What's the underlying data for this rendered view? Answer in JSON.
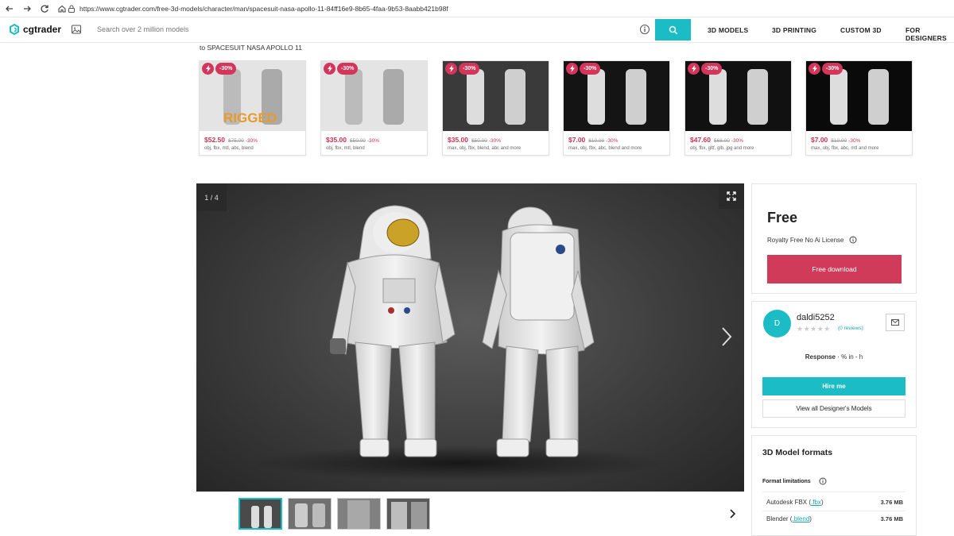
{
  "browser": {
    "url": "https://www.cgtrader.com/free-3d-models/character/man/spacesuit-nasa-apollo-11-84ff16e9-8b65-4faa-9b53-8aabb421b98f"
  },
  "header": {
    "logo_text": "cgtrader",
    "search_placeholder": "Search over 2 million models",
    "nav": [
      "3D MODELS",
      "3D PRINTING",
      "CUSTOM 3D",
      "FOR DESIGNERS"
    ]
  },
  "related": {
    "title": "to SPACESUIT NASA APOLLO 11",
    "cards": [
      {
        "discount": "-30%",
        "price": "$52.50",
        "old_price": "$75.00",
        "pct": "-30%",
        "formats": "obj, fbx, mtl, abc, blend",
        "overlay": "RIGGED"
      },
      {
        "discount": "-30%",
        "price": "$35.00",
        "old_price": "$50.00",
        "pct": "-30%",
        "formats": "obj, fbx, mtl, blend"
      },
      {
        "discount": "-30%",
        "price": "$35.00",
        "old_price": "$50.00",
        "pct": "-30%",
        "formats": "max, obj, fbx, blend, abc and more"
      },
      {
        "discount": "-30%",
        "price": "$7.00",
        "old_price": "$10.00",
        "pct": "-30%",
        "formats": "max, obj, fbx, abc, blend and more"
      },
      {
        "discount": "-30%",
        "price": "$47.60",
        "old_price": "$68.00",
        "pct": "-30%",
        "formats": "obj, fbx, gltf, glb, jpg and more"
      },
      {
        "discount": "-30%",
        "price": "$7.00",
        "old_price": "$10.00",
        "pct": "-30%",
        "formats": "max, obj, fbx, abc, mtl and more"
      }
    ]
  },
  "viewer": {
    "counter": "1 / 4"
  },
  "purchase": {
    "price": "Free",
    "license": "Royalty Free No Ai License",
    "download_label": "Free download"
  },
  "designer": {
    "initial": "D",
    "name": "daldi5252",
    "stars": "★★★★★",
    "reviews": "(0 reviews)",
    "response_label": "Response",
    "response_value": " · % in - h",
    "hire_label": "Hire me",
    "view_all_label": "View all Designer's Models"
  },
  "formats": {
    "title": "3D Model formats",
    "limitations": "Format limitations",
    "items": [
      {
        "name": "Autodesk FBX",
        "ext": ".fbx",
        "size": "3.76 MB"
      },
      {
        "name": "Blender",
        "ext": ".blend",
        "size": "3.76 MB"
      }
    ]
  },
  "colors": {
    "accent": "#1cbcc7",
    "brand_red": "#cf3b59"
  },
  "icons": [
    "back-icon",
    "forward-icon",
    "reload-icon",
    "home-icon",
    "lock-icon",
    "image-search-icon",
    "info-icon",
    "search-icon",
    "bolt-icon",
    "expand-icon",
    "chevron-right-icon",
    "mail-icon"
  ]
}
